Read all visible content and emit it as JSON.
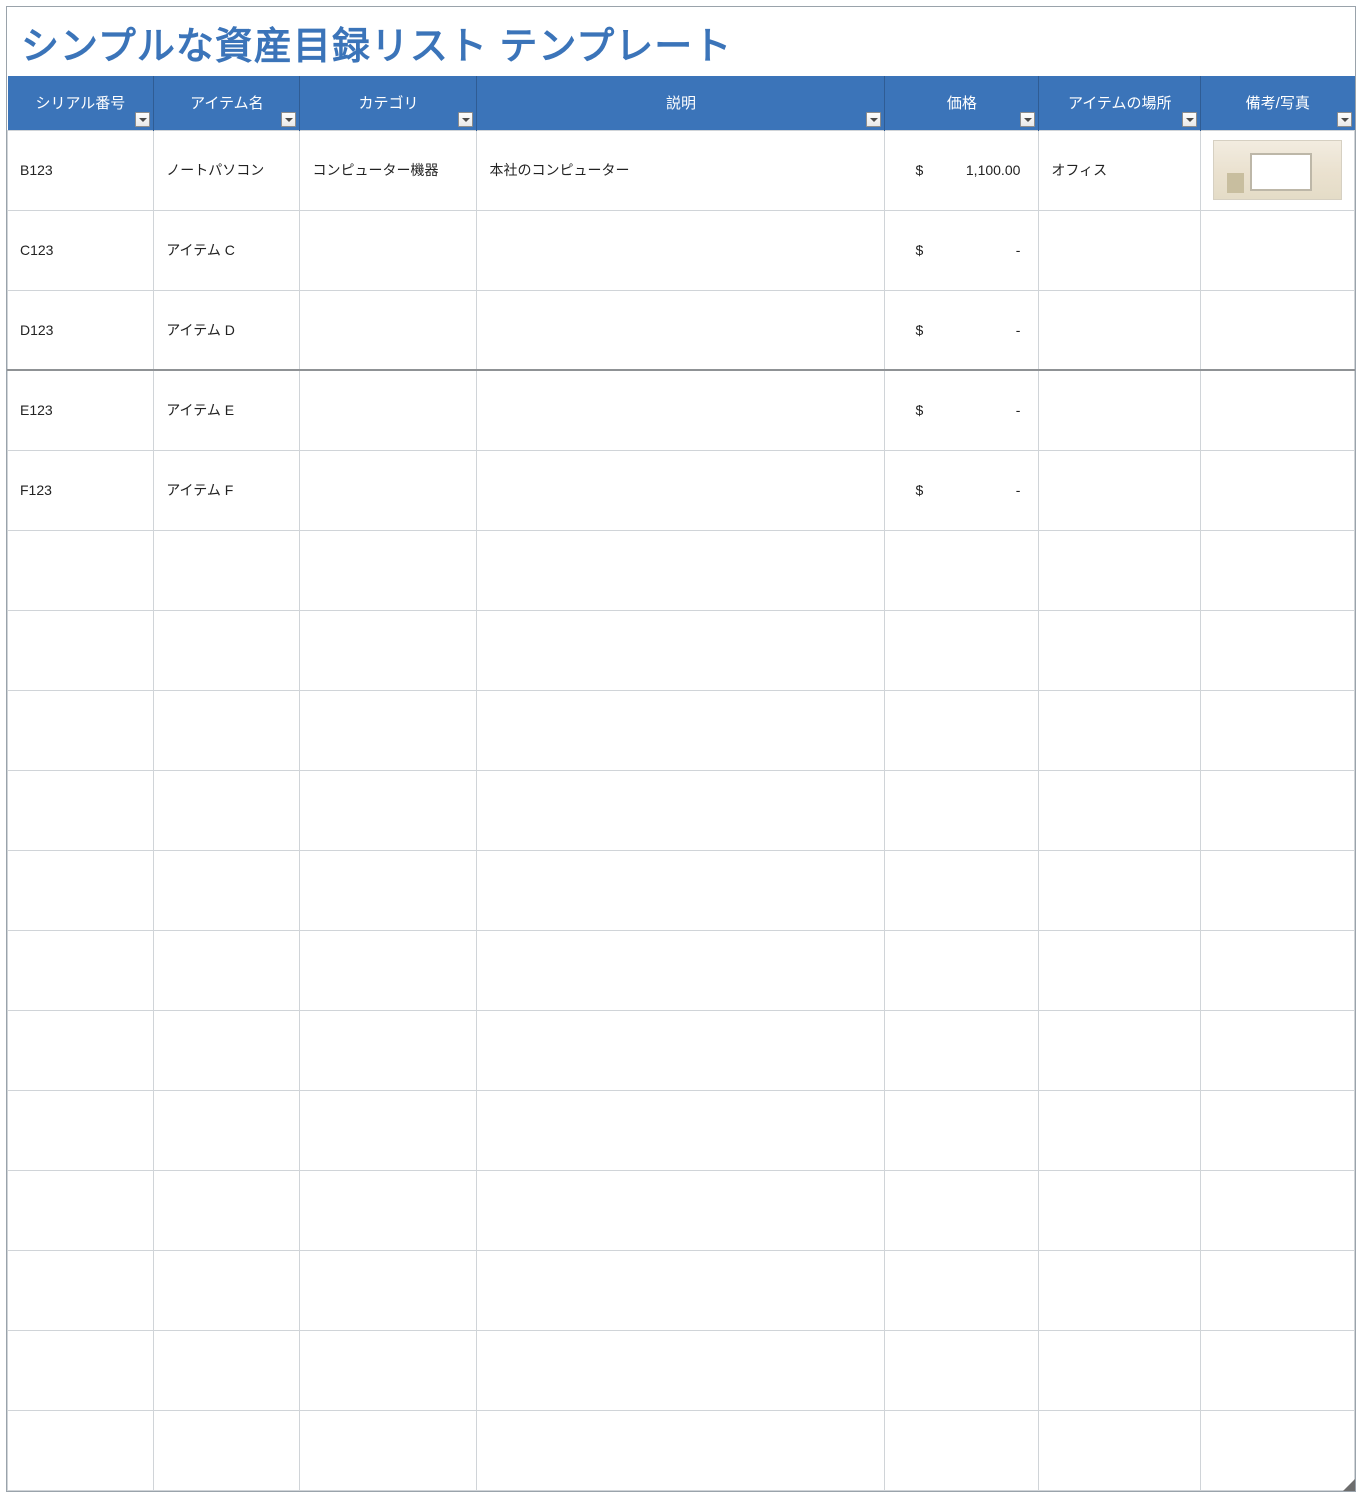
{
  "title": "シンプルな資産目録リスト テンプレート",
  "columns": {
    "serial": "シリアル番号",
    "item": "アイテム名",
    "category": "カテゴリ",
    "desc": "説明",
    "price": "価格",
    "location": "アイテムの場所",
    "note": "備考/写真"
  },
  "rows": [
    {
      "serial": "B123",
      "item": "ノートパソコン",
      "category": "コンピューター機器",
      "desc": "本社のコンピューター",
      "price_cur": "$",
      "price_val": "1,100.00",
      "location": "オフィス",
      "has_photo": true
    },
    {
      "serial": "C123",
      "item": "アイテム C",
      "category": "",
      "desc": "",
      "price_cur": "$",
      "price_val": "-",
      "location": "",
      "has_photo": false
    },
    {
      "serial": "D123",
      "item": "アイテム D",
      "category": "",
      "desc": "",
      "price_cur": "$",
      "price_val": "-",
      "location": "",
      "has_photo": false
    },
    {
      "serial": "E123",
      "item": "アイテム E",
      "category": "",
      "desc": "",
      "price_cur": "$",
      "price_val": "-",
      "location": "",
      "has_photo": false,
      "sep": true
    },
    {
      "serial": "F123",
      "item": "アイテム F",
      "category": "",
      "desc": "",
      "price_cur": "$",
      "price_val": "-",
      "location": "",
      "has_photo": false
    },
    {},
    {},
    {},
    {},
    {},
    {},
    {},
    {},
    {},
    {},
    {},
    {}
  ]
}
